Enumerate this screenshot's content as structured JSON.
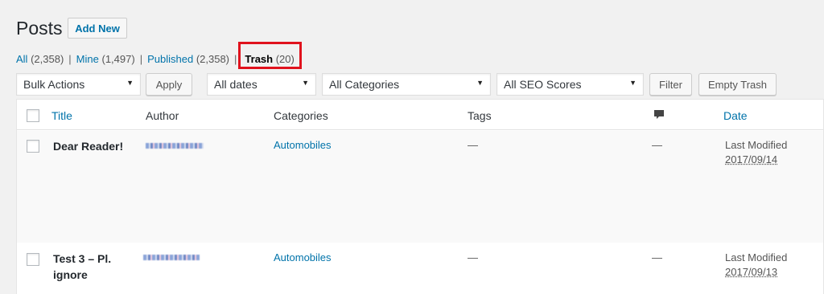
{
  "header": {
    "title": "Posts",
    "add_new_label": "Add New"
  },
  "views": {
    "all_label": "All",
    "all_count": "(2,358)",
    "mine_label": "Mine",
    "mine_count": "(1,497)",
    "published_label": "Published",
    "published_count": "(2,358)",
    "trash_label": "Trash",
    "trash_count": "(20)",
    "separator": "|"
  },
  "filters": {
    "bulk_actions": "Bulk Actions",
    "apply_label": "Apply",
    "dates": "All dates",
    "categories": "All Categories",
    "seo_scores": "All SEO Scores",
    "filter_label": "Filter",
    "empty_trash_label": "Empty Trash"
  },
  "table": {
    "columns": {
      "title": "Title",
      "author": "Author",
      "categories": "Categories",
      "tags": "Tags",
      "date": "Date"
    },
    "rows": [
      {
        "title": "Dear Reader!",
        "category": "Automobiles",
        "tags": "—",
        "comments": "—",
        "date_label": "Last Modified",
        "date": "2017/09/14"
      },
      {
        "title_line1": "Test 3 – Pl.",
        "title_line2": "ignore",
        "category": "Automobiles",
        "tags": "—",
        "comments": "—",
        "date_label": "Last Modified",
        "date": "2017/09/13"
      }
    ]
  },
  "colors": {
    "link": "#0073aa",
    "highlight_box": "#e0121d"
  }
}
